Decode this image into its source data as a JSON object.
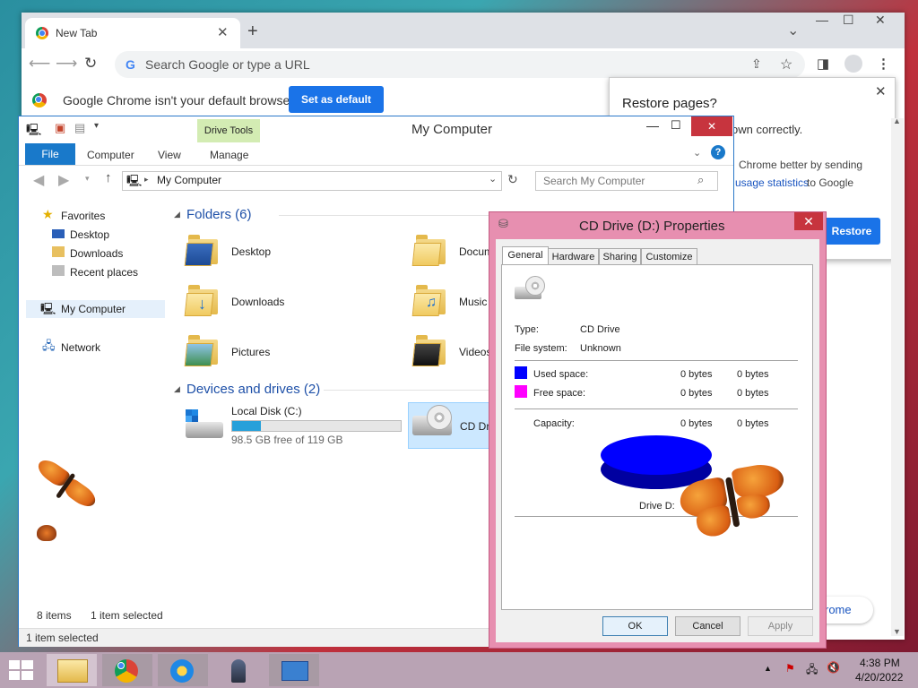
{
  "chrome": {
    "tab_title": "New Tab",
    "tab_close": "✕",
    "new_tab": "+",
    "tab_search": "⌄",
    "minimize": "—",
    "maximize": "☐",
    "close": "✕",
    "omnibox_placeholder": "Search Google or type a URL",
    "omnibox_g": "G",
    "infobar_text": "Google Chrome isn't your default browser",
    "set_default": "Set as default",
    "restore_title": "Restore pages?",
    "restore_line1": "own correctly.",
    "restore_line2": "Chrome better by sending",
    "restore_link": "usage statistics",
    "restore_line3": " to Google",
    "restore_button": "Restore",
    "restore_close": "✕",
    "bottom_pill": "rome"
  },
  "explorer": {
    "title": "My Computer",
    "drive_tools": "Drive Tools",
    "ribbon_tabs": [
      "File",
      "Computer",
      "View",
      "Manage"
    ],
    "address": "My Computer",
    "search_placeholder": "Search My Computer",
    "nav": {
      "favorites": "Favorites",
      "desktop": "Desktop",
      "downloads": "Downloads",
      "recent": "Recent places",
      "my_computer": "My Computer",
      "network": "Network"
    },
    "folders_header": "Folders (6)",
    "folders": [
      "Desktop",
      "Docum",
      "Downloads",
      "Music",
      "Pictures",
      "Videos"
    ],
    "devices_header": "Devices and drives (2)",
    "local_disk": "Local Disk (C:)",
    "local_disk_free": "98.5 GB free of 119 GB",
    "local_disk_used_fraction": 0.17,
    "cd_drive": "CD Dri",
    "items_count": "8 items",
    "selected_count": "1 item selected",
    "bottom_status": "1 item selected"
  },
  "properties": {
    "title": "CD Drive (D:) Properties",
    "close": "✕",
    "tabs": [
      "General",
      "Hardware",
      "Sharing",
      "Customize"
    ],
    "type_label": "Type:",
    "type_value": "CD Drive",
    "fs_label": "File system:",
    "fs_value": "Unknown",
    "used_label": "Used space:",
    "used_bytes": "0 bytes",
    "used_bytes2": "0 bytes",
    "free_label": "Free space:",
    "free_bytes": "0 bytes",
    "free_bytes2": "0 bytes",
    "capacity_label": "Capacity:",
    "capacity_bytes": "0 bytes",
    "capacity_bytes2": "0 bytes",
    "drive_label": "Drive D:",
    "ok": "OK",
    "cancel": "Cancel",
    "apply": "Apply",
    "used_color": "#0000ff",
    "free_color": "#ff00ff"
  },
  "taskbar": {
    "time": "4:38 PM",
    "date": "4/20/2022"
  }
}
